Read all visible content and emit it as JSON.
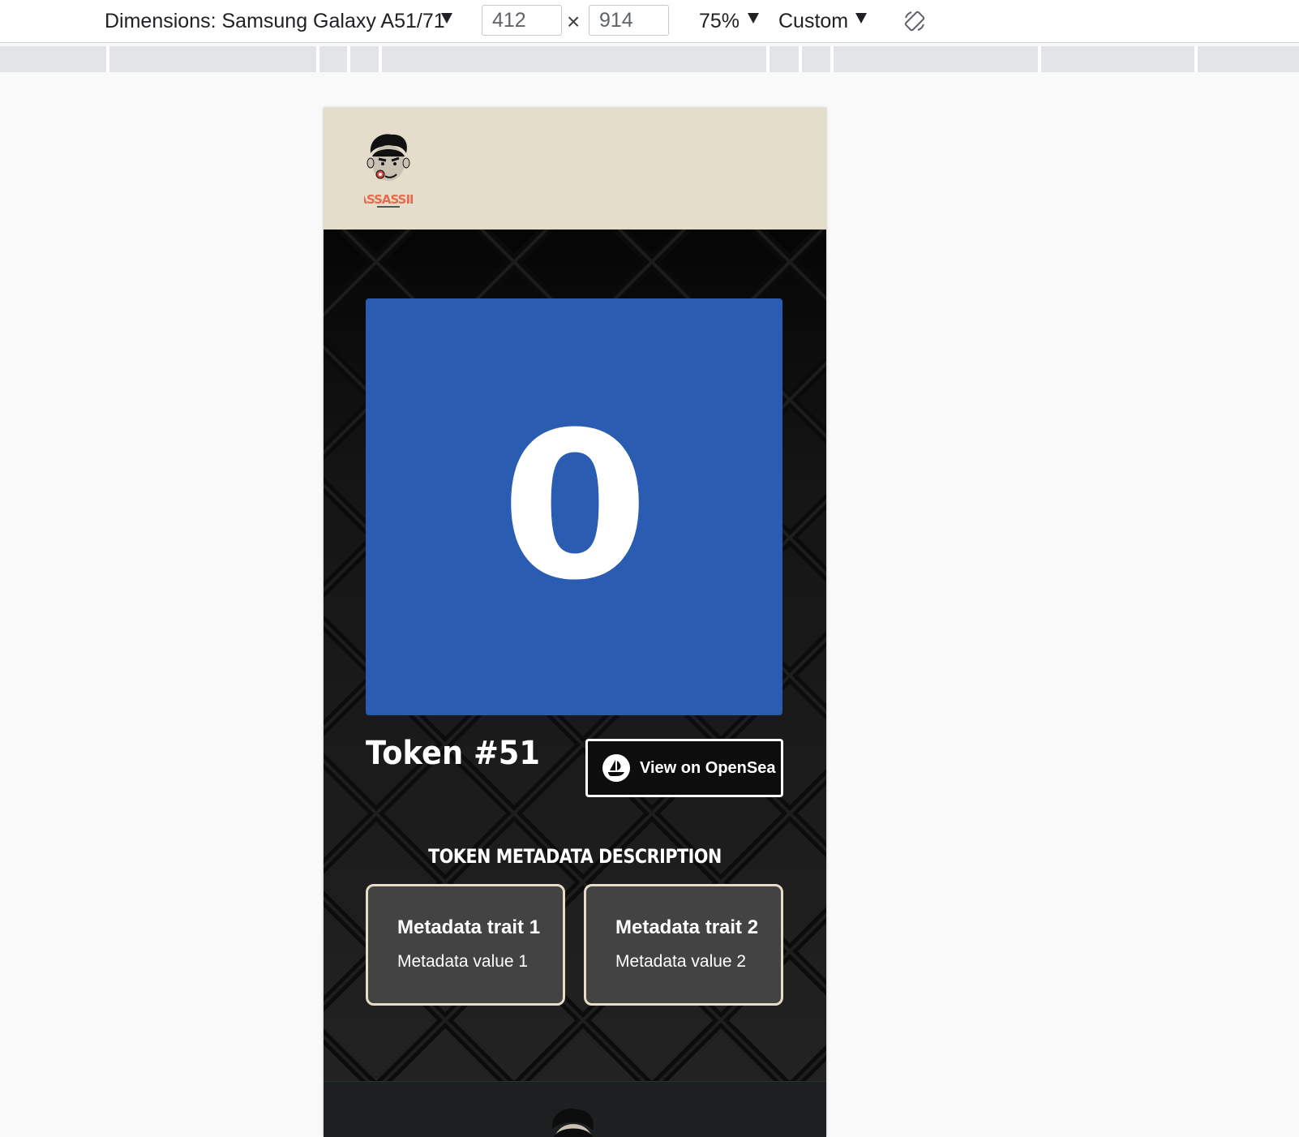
{
  "devtools": {
    "dimensions_label": "Dimensions: Samsung Galaxy A51/71",
    "width": "412",
    "height": "914",
    "times_symbol": "×",
    "zoom": "75%",
    "throttle": "Custom",
    "rotate_icon": "rotate-icon"
  },
  "site": {
    "logo_text": "ASSASSIN",
    "token": {
      "image_number": "0",
      "image_color": "#2a5db1",
      "title": "Token #51",
      "opensea_label": "View on OpenSea"
    },
    "metadata": {
      "heading": "TOKEN METADATA DESCRIPTION",
      "traits": [
        {
          "name": "Metadata trait 1",
          "value": "Metadata value 1"
        },
        {
          "name": "Metadata trait 2",
          "value": "Metadata value 2"
        }
      ]
    }
  },
  "colors": {
    "header_bg": "#e5ddcc",
    "card_border": "#e8dcc6",
    "card_bg": "#434343",
    "logo_accent": "#e86a4d"
  }
}
